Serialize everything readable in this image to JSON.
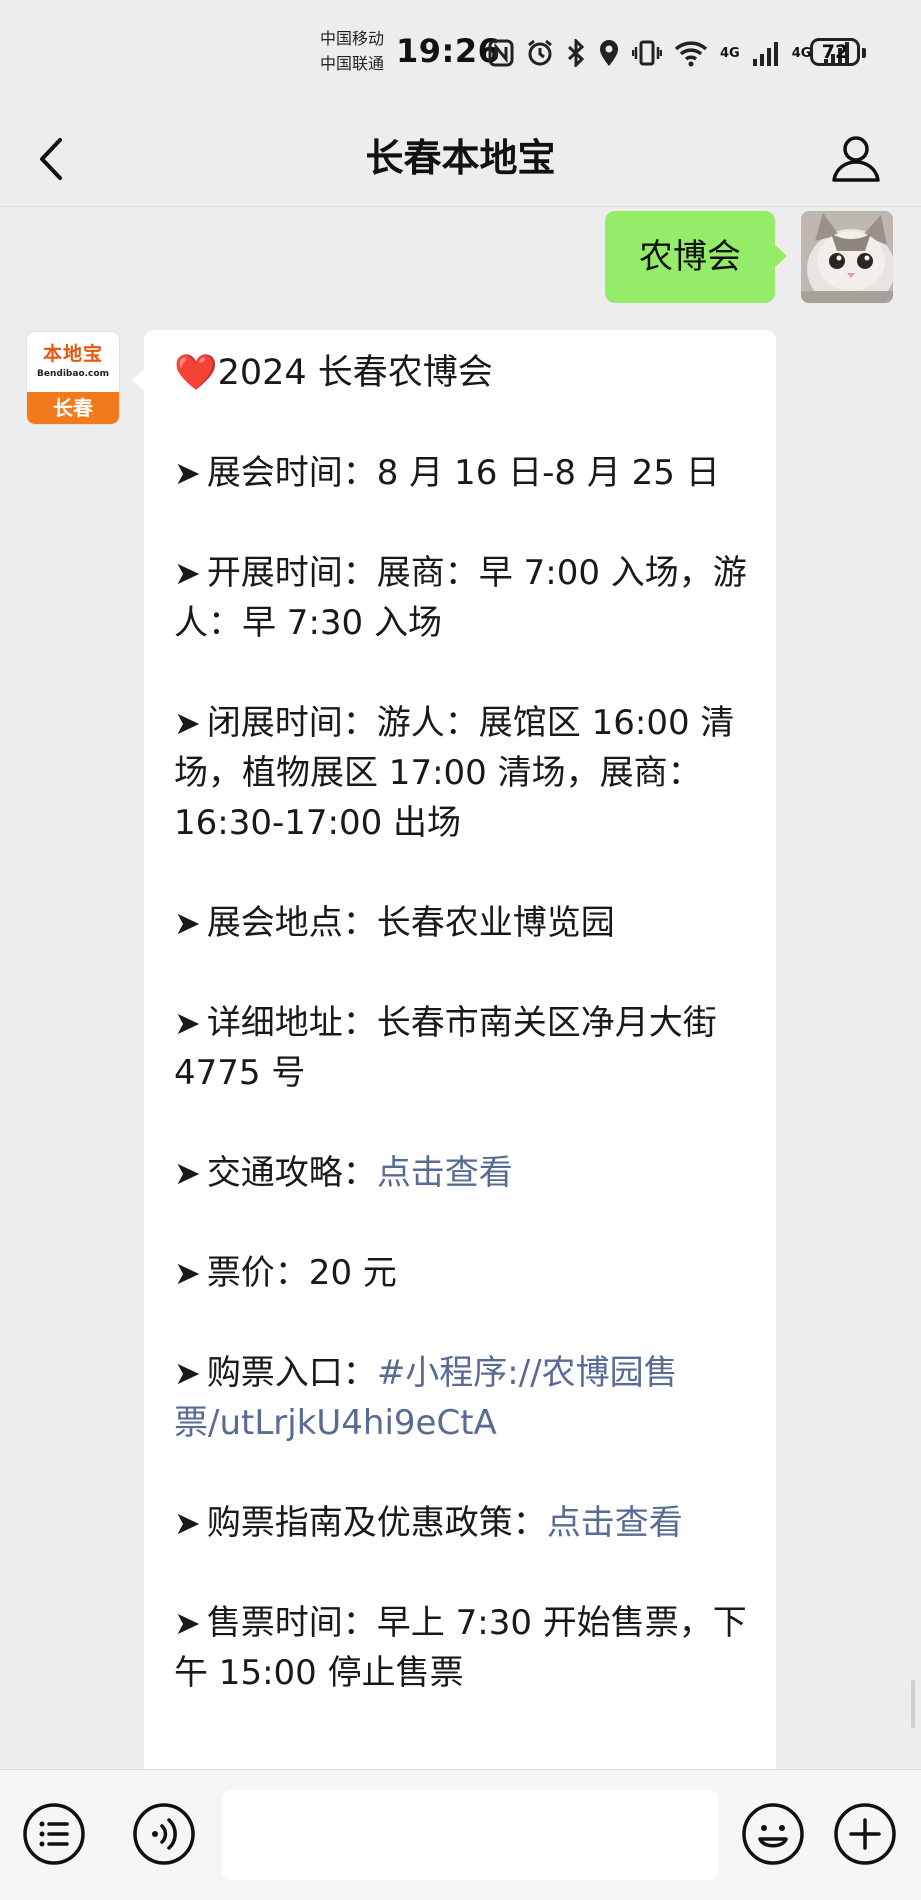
{
  "status_bar": {
    "carrier_1": "中国移动",
    "carrier_2": "中国联通",
    "time": "19:26",
    "network_1": "4G",
    "network_2": "4G",
    "battery": "72"
  },
  "nav": {
    "title": "长春本地宝"
  },
  "messages": {
    "user_text": "农博会",
    "bot_avatar": {
      "brand": "本地宝",
      "url": "Bendibao.com",
      "city": "长春"
    },
    "bot": {
      "title_icon": "❤️",
      "title": "2024 长春农博会",
      "arrow": "➤",
      "lines": [
        {
          "text": "展会时间：8 月 16 日-8 月 25 日"
        },
        {
          "text": "开展时间：展商：早 7:00 入场，游人：早 7:30 入场"
        },
        {
          "text": "闭展时间：游人：展馆区 16:00 清场，植物展区 17:00 清场，展商：16:30-17:00 出场"
        },
        {
          "text": "展会地点：长春农业博览园"
        },
        {
          "text": "详细地址：长春市南关区净月大街 4775 号"
        },
        {
          "text": "交通攻略：",
          "link": "点击查看"
        },
        {
          "text": "票价：20 元"
        },
        {
          "text": "购票入口：",
          "link": "#小程序://农博园售票/utLrjkU4hi9eCtA"
        },
        {
          "text": "购票指南及优惠政策：",
          "link": "点击查看"
        },
        {
          "text": "售票时间：早上 7:30 开始售票，下午 15:00 停止售票"
        }
      ]
    }
  },
  "input_bar": {
    "text": "",
    "placeholder": ""
  },
  "colors": {
    "background": "#ededed",
    "user_bubble": "#95ec69",
    "link": "#576b95",
    "brand_orange": "#f07a1c"
  }
}
